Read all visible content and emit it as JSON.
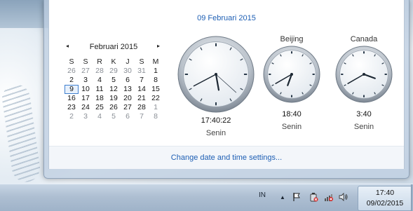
{
  "flyout": {
    "date_header": "09 Februari 2015",
    "settings_link": "Change date and time settings..."
  },
  "calendar": {
    "month_label": "Februari 2015",
    "prev_glyph": "◂",
    "next_glyph": "▸",
    "weekdays": [
      "S",
      "S",
      "R",
      "K",
      "J",
      "S",
      "M"
    ],
    "weeks": [
      [
        "26",
        "27",
        "28",
        "29",
        "30",
        "31",
        "1"
      ],
      [
        "2",
        "3",
        "4",
        "5",
        "6",
        "7",
        "8"
      ],
      [
        "9",
        "10",
        "11",
        "12",
        "13",
        "14",
        "15"
      ],
      [
        "16",
        "17",
        "18",
        "19",
        "20",
        "21",
        "22"
      ],
      [
        "23",
        "24",
        "25",
        "26",
        "27",
        "28",
        "1"
      ],
      [
        "2",
        "3",
        "4",
        "5",
        "6",
        "7",
        "8"
      ]
    ],
    "selected_day": "9"
  },
  "clocks": [
    {
      "name": "",
      "time": "17:40:22",
      "day": "Senin",
      "hour": 17,
      "minute": 40,
      "second": 22
    },
    {
      "name": "Beijing",
      "time": "18:40",
      "day": "Senin",
      "hour": 18,
      "minute": 40
    },
    {
      "name": "Canada",
      "time": "3:40",
      "day": "Senin",
      "hour": 3,
      "minute": 40
    }
  ],
  "taskbar": {
    "language": "IN",
    "show_hidden_glyph": "▲",
    "clock_time": "17:40",
    "clock_date": "09/02/2015"
  },
  "icons": [
    "flag-icon",
    "power-icon",
    "network-icon",
    "volume-icon",
    "chevron-left-icon",
    "chevron-right-icon"
  ]
}
